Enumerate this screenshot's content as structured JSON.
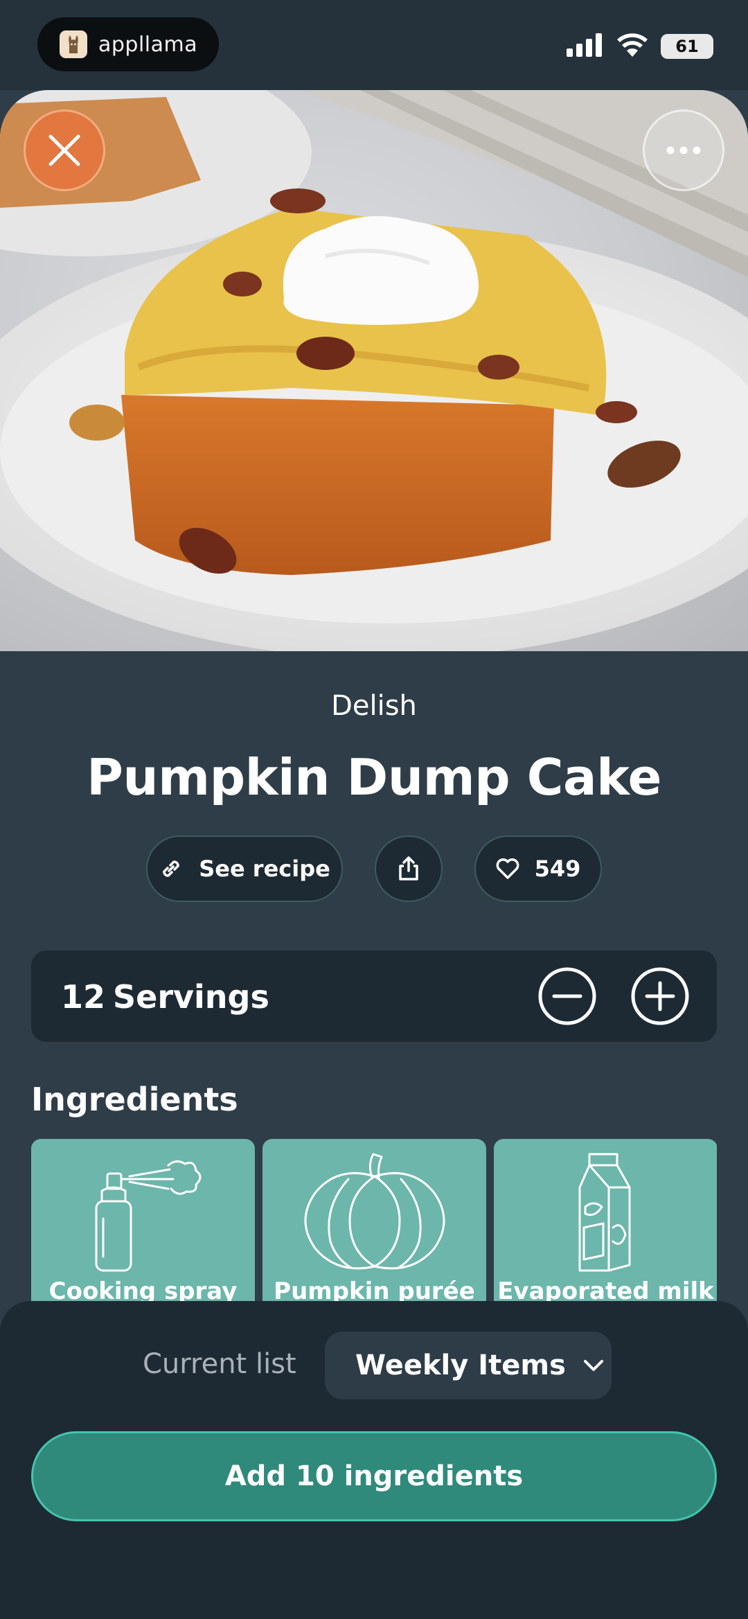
{
  "status_bar": {
    "app_name": "appllama",
    "battery": "61"
  },
  "recipe": {
    "source": "Delish",
    "title": "Pumpkin Dump Cake",
    "see_recipe_label": "See recipe",
    "likes": "549"
  },
  "servings": {
    "count": "12",
    "label": "Servings"
  },
  "ingredients": {
    "heading": "Ingredients",
    "items": [
      {
        "label": "Cooking spray",
        "icon": "spray-can-icon"
      },
      {
        "label": "Pumpkin purée",
        "icon": "pumpkin-icon"
      },
      {
        "label": "Evaporated milk",
        "icon": "milk-carton-icon"
      }
    ]
  },
  "list": {
    "current_label": "Current list",
    "selected": "Weekly Items"
  },
  "add_button": {
    "label": "Add 10 ingredients"
  },
  "colors": {
    "accent": "#2f8a7b",
    "tile": "#6cb6ab",
    "background": "#2f3d48",
    "close": "#e6733c"
  }
}
